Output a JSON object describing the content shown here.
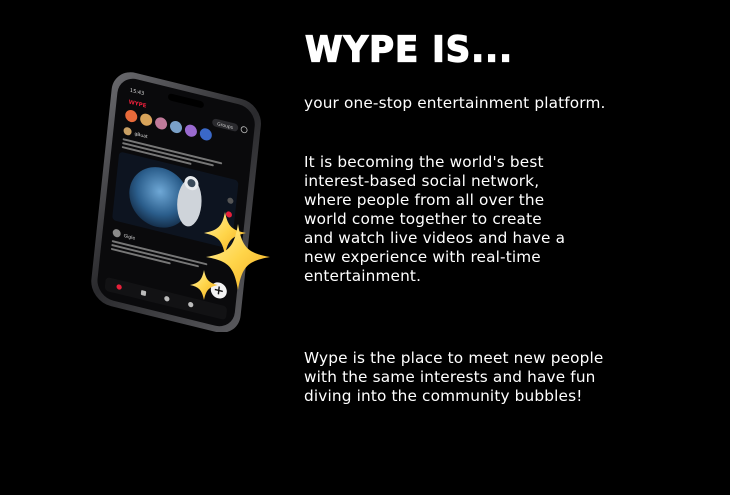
{
  "heading": "WYPE IS...",
  "paragraphs": [
    [
      "your one-stop entertainment platform."
    ],
    [
      "It is becoming the world's best",
      "interest-based social network,",
      "where people from all over the",
      "world come together to create",
      "and watch live videos and have a",
      "new experience with real-time",
      "entertainment."
    ],
    [
      "Wype is the place to meet new people",
      "with the same interests and have fun",
      "diving into the community bubbles!"
    ]
  ],
  "phone_screen": {
    "app_name": "WYPE",
    "time": "15:43",
    "groups_label": "Groups",
    "first_user": "gBuat",
    "second_user": "Gigle"
  },
  "colors": {
    "background": "#000000",
    "text": "#ffffff",
    "sparkle": "#ffd54a",
    "accent": "#e8203a"
  }
}
